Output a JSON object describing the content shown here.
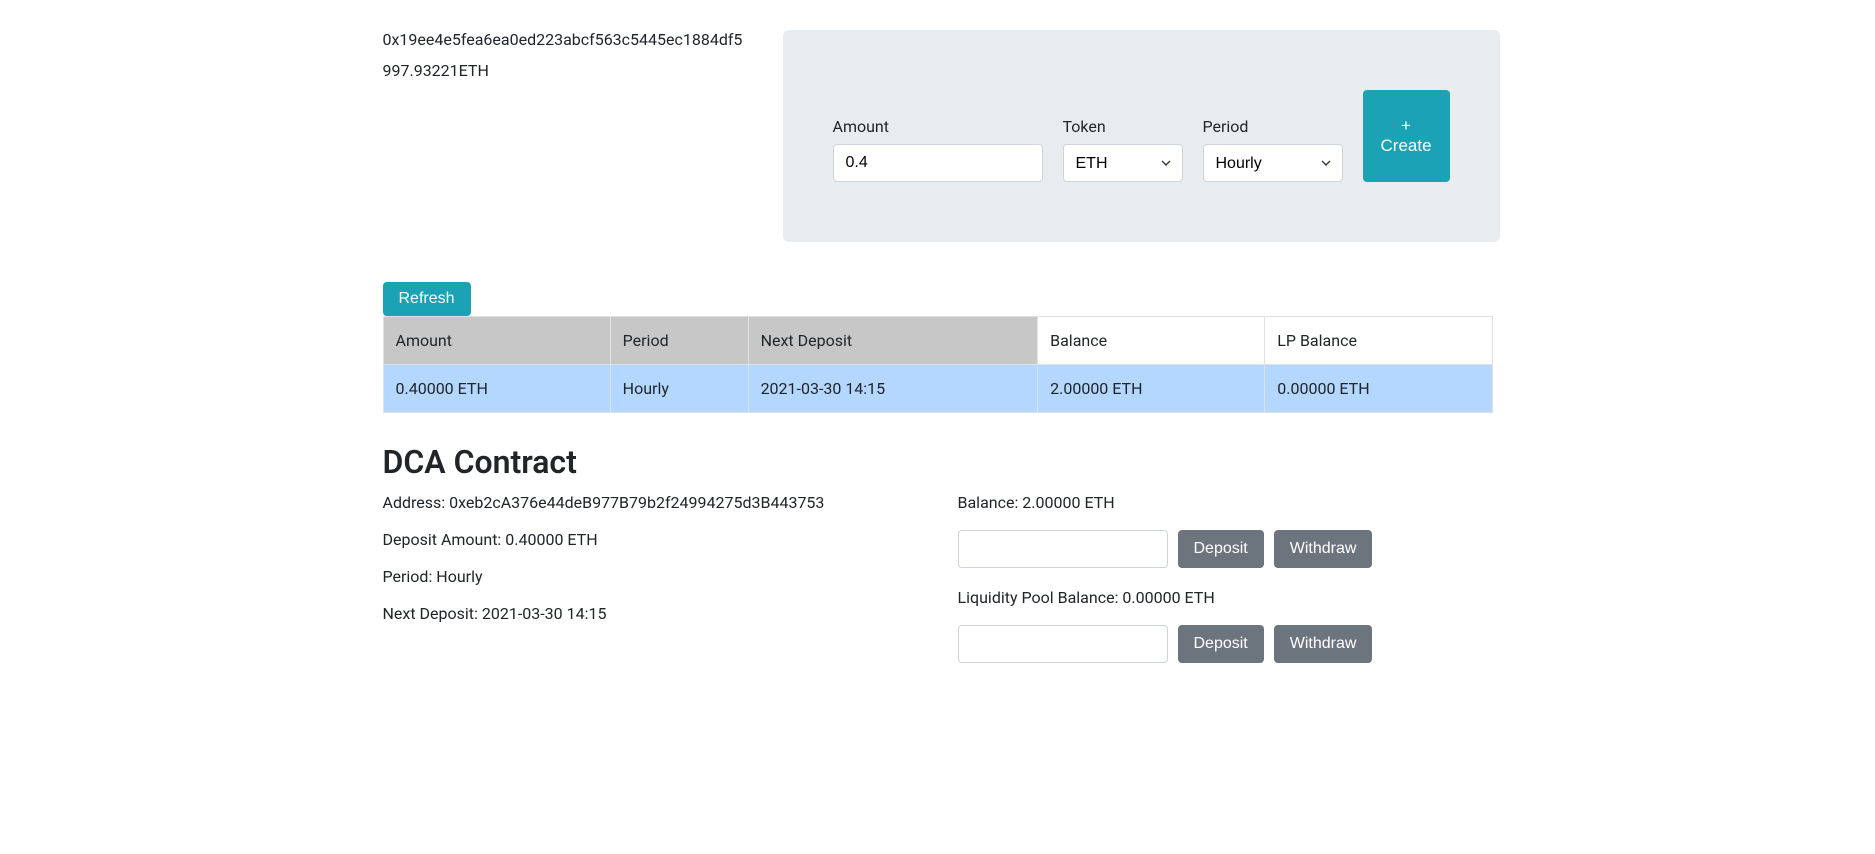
{
  "wallet": {
    "address": "0x19ee4e5fea6ea0ed223abcf563c5445ec1884df5",
    "balance": "997.93221ETH"
  },
  "createForm": {
    "amountLabel": "Amount",
    "amountValue": "0.4",
    "tokenLabel": "Token",
    "tokenValue": "ETH",
    "periodLabel": "Period",
    "periodValue": "Hourly",
    "createButton": "+ Create"
  },
  "refreshButton": "Refresh",
  "table": {
    "headers": {
      "amount": "Amount",
      "period": "Period",
      "nextDeposit": "Next Deposit",
      "balance": "Balance",
      "lpBalance": "LP Balance"
    },
    "row": {
      "amount": "0.40000 ETH",
      "period": "Hourly",
      "nextDeposit": "2021-03-30 14:15",
      "balance": "2.00000 ETH",
      "lpBalance": "0.00000 ETH"
    }
  },
  "contract": {
    "title": "DCA Contract",
    "addressLabel": "Address: 0xeb2cA376e44deB977B79b2f24994275d3B443753",
    "depositAmountLabel": "Deposit Amount: 0.40000 ETH",
    "periodLabel": "Period: Hourly",
    "nextDepositLabel": "Next Deposit: 2021-03-30 14:15",
    "balanceLabel": "Balance: 2.00000 ETH",
    "lpBalanceLabel": "Liquidity Pool Balance: 0.00000 ETH",
    "depositButton": "Deposit",
    "withdrawButton": "Withdraw"
  }
}
